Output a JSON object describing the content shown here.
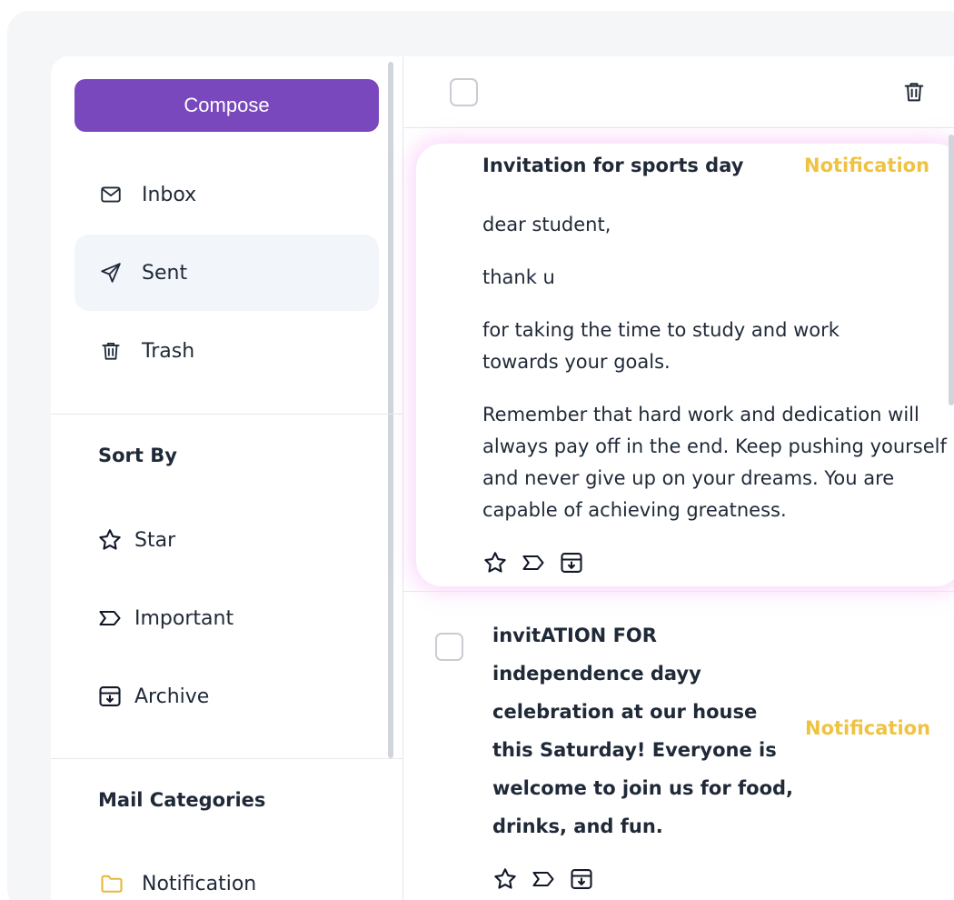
{
  "sidebar": {
    "compose_label": "Compose",
    "nav": [
      {
        "label": "Inbox",
        "icon": "mail-icon"
      },
      {
        "label": "Sent",
        "icon": "send-icon",
        "active": true
      },
      {
        "label": "Trash",
        "icon": "trash-icon"
      }
    ],
    "sort_heading": "Sort By",
    "filters": [
      {
        "label": "Star",
        "icon": "star-icon"
      },
      {
        "label": "Important",
        "icon": "important-tag-icon"
      },
      {
        "label": "Archive",
        "icon": "archive-icon"
      }
    ],
    "categories_heading": "Mail Categories",
    "categories": [
      {
        "label": "Notification",
        "icon": "folder-icon",
        "color": "#e6b93c"
      }
    ]
  },
  "mail_list": {
    "items": [
      {
        "title": "Invitation for sports day",
        "tag": "Notification",
        "body": [
          "dear student,",
          "thank u",
          "for taking the time to study and work towards your goals.",
          "Remember that hard work and dedication will always pay off in the end. Keep pushing yourself and never give up on your dreams. You are capable of achieving greatness."
        ],
        "expanded": true
      },
      {
        "title": "invitATION FOR independence dayy celebration at our house this Saturday! Everyone is welcome to join us for food, drinks, and fun.",
        "tag": "Notification",
        "expanded": false
      }
    ]
  },
  "colors": {
    "accent": "#7a48bd",
    "tag": "#efc341",
    "active_bg": "#f2f5fa"
  }
}
